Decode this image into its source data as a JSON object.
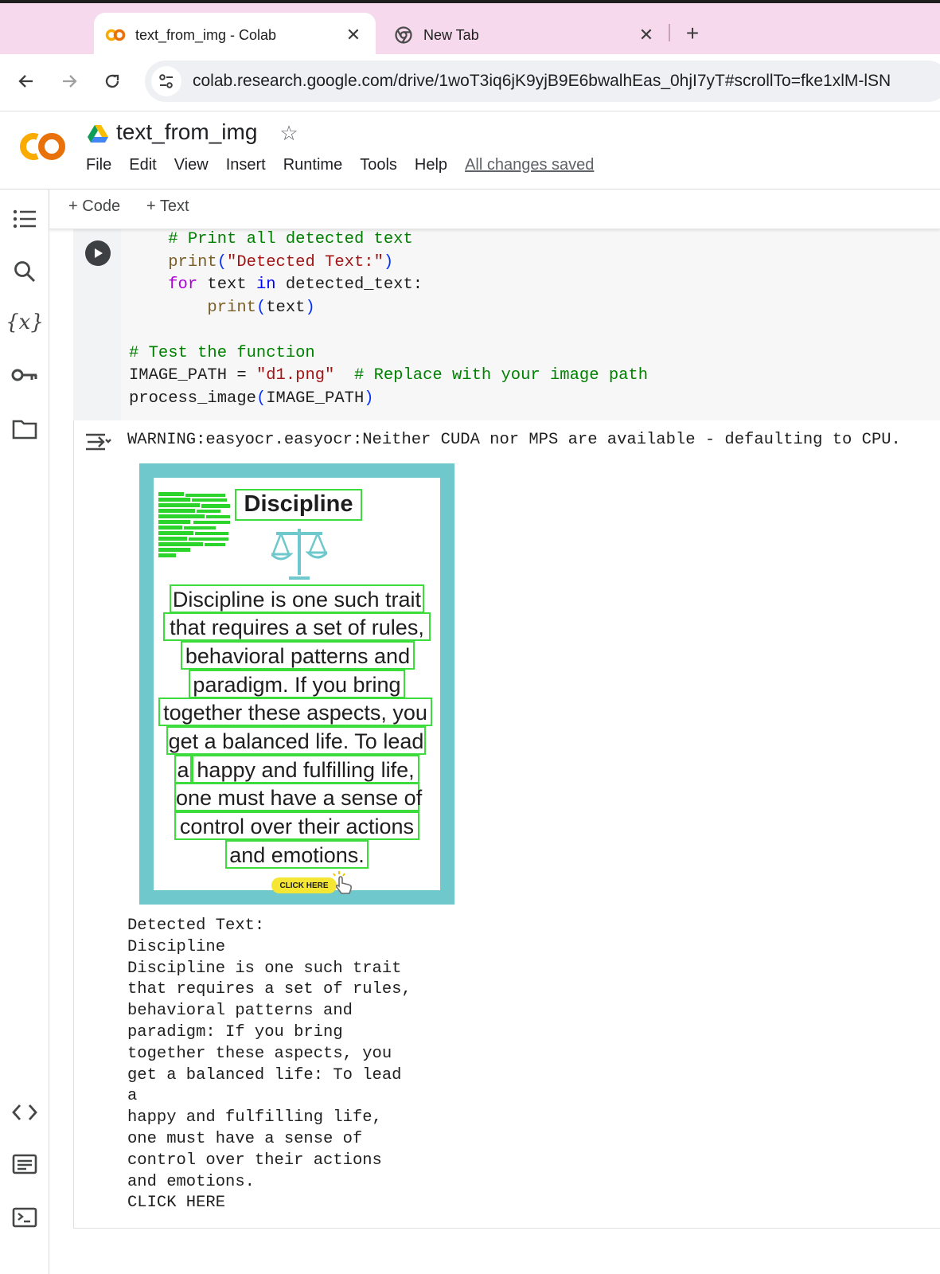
{
  "browser": {
    "tabs": [
      {
        "title": "text_from_img - Colab",
        "active": true,
        "icon": "colab-icon"
      },
      {
        "title": "New Tab",
        "active": false,
        "icon": "chrome-icon"
      }
    ],
    "url": "colab.research.google.com/drive/1woT3iq6jK9yjB9E6bwalhEas_0hjI7yT#scrollTo=fke1xlM-lSN"
  },
  "colab": {
    "notebook_title": "text_from_img",
    "menu": [
      "File",
      "Edit",
      "View",
      "Insert",
      "Runtime",
      "Tools",
      "Help"
    ],
    "save_status": "All changes saved",
    "toolbar": {
      "add_code": "Code",
      "add_text": "Text"
    }
  },
  "cell": {
    "code_lines": [
      [
        {
          "t": "    ",
          "c": ""
        },
        {
          "t": "# Print all detected text",
          "c": "com"
        }
      ],
      [
        {
          "t": "    ",
          "c": ""
        },
        {
          "t": "print",
          "c": "fn"
        },
        {
          "t": "(",
          "c": "par"
        },
        {
          "t": "\"Detected Text:\"",
          "c": "str"
        },
        {
          "t": ")",
          "c": "par"
        }
      ],
      [
        {
          "t": "    ",
          "c": ""
        },
        {
          "t": "for",
          "c": "kw"
        },
        {
          "t": " text ",
          "c": ""
        },
        {
          "t": "in",
          "c": "kw2"
        },
        {
          "t": " detected_text:",
          "c": ""
        }
      ],
      [
        {
          "t": "        ",
          "c": ""
        },
        {
          "t": "print",
          "c": "fn"
        },
        {
          "t": "(",
          "c": "par"
        },
        {
          "t": "text",
          "c": ""
        },
        {
          "t": ")",
          "c": "par"
        }
      ],
      [
        {
          "t": "",
          "c": ""
        }
      ],
      [
        {
          "t": "# Test the function",
          "c": "com"
        }
      ],
      [
        {
          "t": "IMAGE_PATH = ",
          "c": ""
        },
        {
          "t": "\"d1.png\"",
          "c": "str"
        },
        {
          "t": "  ",
          "c": ""
        },
        {
          "t": "# Replace with your image path",
          "c": "com"
        }
      ],
      [
        {
          "t": "process_image",
          "c": ""
        },
        {
          "t": "(",
          "c": "par"
        },
        {
          "t": "IMAGE_PATH",
          "c": ""
        },
        {
          "t": ")",
          "c": "par"
        }
      ]
    ],
    "warning": "WARNING:easyocr.easyocr:Neither CUDA nor MPS are available - defaulting to CPU.",
    "image": {
      "title": "Discipline",
      "lines": [
        "Discipline is one such trait",
        "that requires a set of rules,",
        "behavioral patterns and",
        "paradigm. If you bring",
        "together these aspects, you",
        "get a balanced life. To lead",
        "a",
        "happy and fulfilling life,",
        "one must have a sense of",
        "control over their actions",
        "and emotions."
      ],
      "button": "CLICK HERE"
    },
    "output_lines": [
      "Detected Text:",
      "Discipline",
      "Discipline is one such trait",
      "that requires a set of rules,",
      "behavioral patterns and",
      "paradigm: If you bring",
      "together these aspects, you",
      "get a balanced life: To lead",
      "a",
      "happy and fulfilling life,",
      "one must have a sense of",
      "control over their actions",
      "and emotions.",
      "CLICK HERE"
    ]
  },
  "sidebar_icons": [
    "table-of-contents-icon",
    "search-icon",
    "variables-icon",
    "secrets-key-icon",
    "files-folder-icon",
    "code-snippets-icon",
    "command-palette-icon",
    "terminal-icon"
  ]
}
